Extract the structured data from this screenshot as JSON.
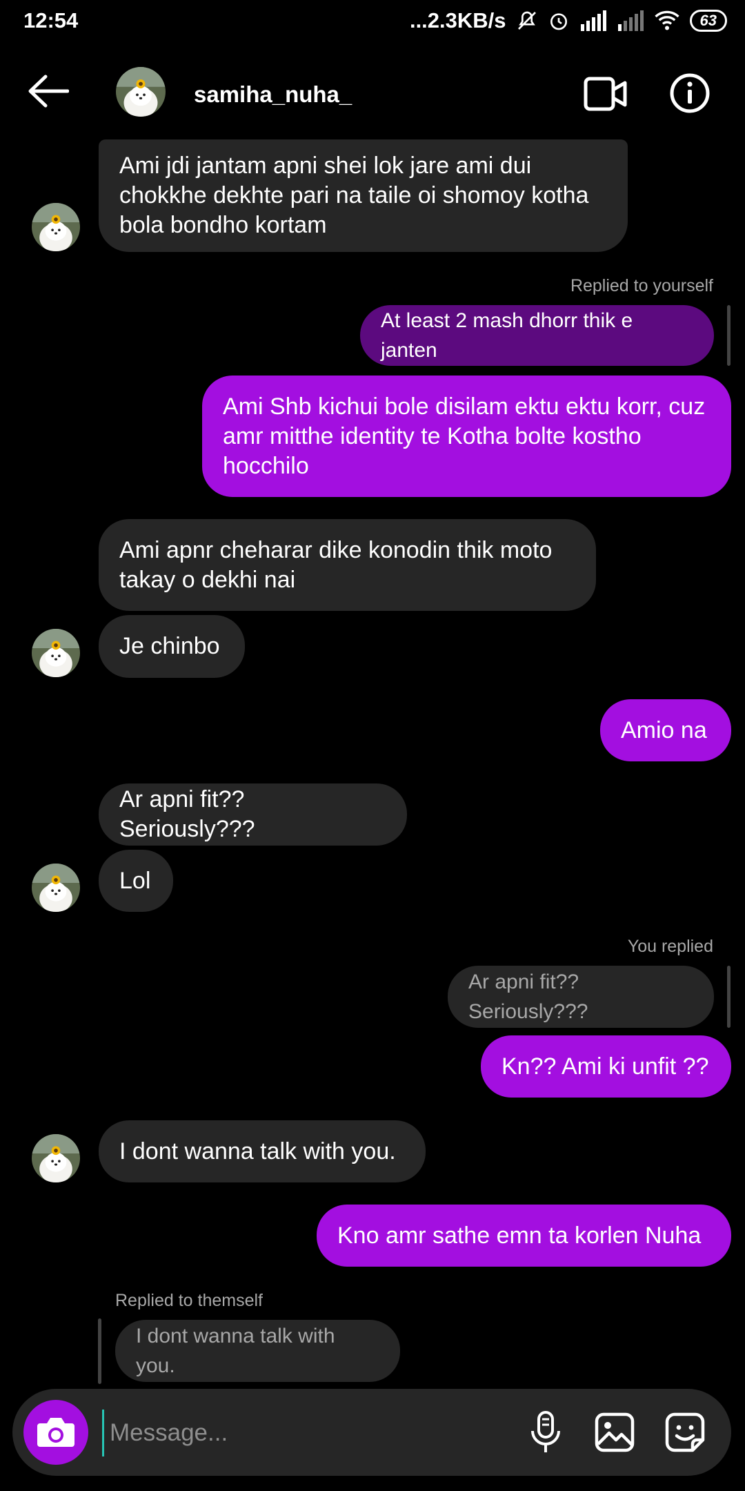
{
  "status_bar": {
    "time": "12:54",
    "net_speed": "...2.3KB/s",
    "battery": "63"
  },
  "header": {
    "username": "samiha_nuha_"
  },
  "messages": {
    "m1": "Ami jdi jantam apni shei lok jare ami dui chokkhe dekhte pari na taile oi shomoy kotha bola bondho kortam",
    "reply1_label": "Replied to yourself",
    "m2": "At least 2 mash dhorr thik e janten",
    "m3": "Ami Shb kichui bole disilam ektu ektu korr, cuz amr mitthe identity te Kotha bolte kostho hocchilo",
    "m4": "Ami apnr cheharar dike konodin thik moto takay o dekhi nai",
    "m5": "Je chinbo",
    "m6": "Amio na",
    "m7": "Ar apni fit?? Seriously???",
    "m8": "Lol",
    "reply2_label": "You replied",
    "reply2_quote": "Ar apni fit?? Seriously???",
    "m9": "Kn?? Ami ki unfit ??",
    "m10": "I dont wanna talk with you.",
    "m11": "Kno amr sathe emn ta korlen Nuha",
    "reply3_label": "Replied to themself",
    "reply3_quote": "I dont wanna talk with you."
  },
  "composer": {
    "placeholder": "Message..."
  },
  "colors": {
    "outgoing": "#a30fe0",
    "incoming": "#262626",
    "background": "#000000"
  }
}
